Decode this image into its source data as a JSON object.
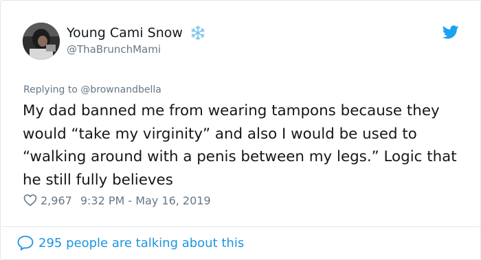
{
  "tweet": {
    "display_name": "Young Cami Snow",
    "display_name_icon": "snowflake-icon",
    "handle": "@ThaBrunchMami",
    "replying_prefix": "Replying to",
    "replying_to": "@brownandbella",
    "text": "My dad banned me from wearing tampons because they would “take my virginity” and also I would be used to “walking around with a penis between my legs.” Logic that he still fully believes",
    "like_count": "2,967",
    "timestamp": "9:32 PM - May 16, 2019",
    "talking_about": "295 people are talking about this"
  },
  "icons": {
    "logo": "twitter-bird-icon",
    "like": "heart-icon",
    "talking": "speech-bubble-icon",
    "avatar": "avatar"
  },
  "colors": {
    "text": "#14171a",
    "secondary_text": "#657786",
    "twitter_blue": "#1da1f2",
    "link_blue": "#1b95e0",
    "snowflake": "#77c5ee",
    "border": "#e1e8ed"
  }
}
